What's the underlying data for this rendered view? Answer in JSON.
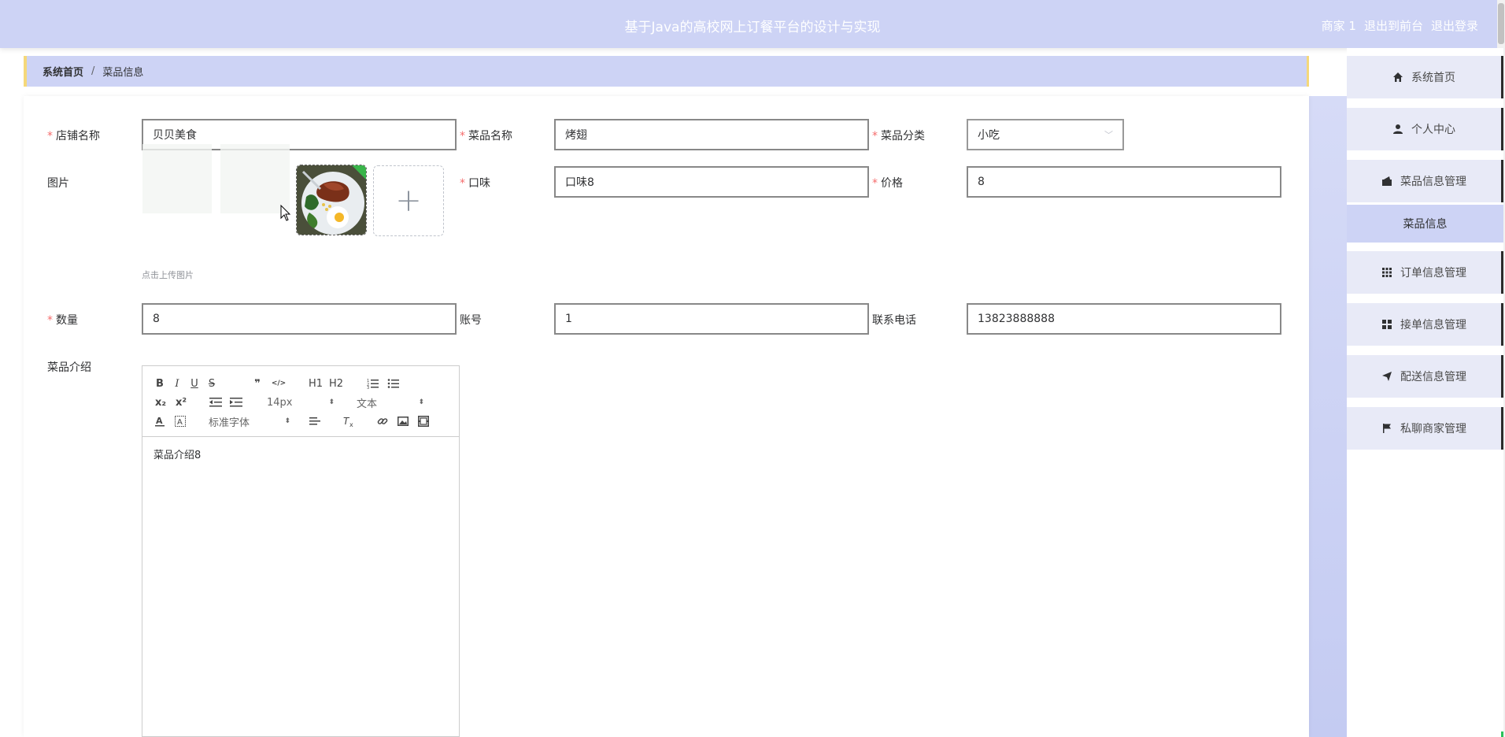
{
  "header": {
    "title": "基于Java的高校网上订餐平台的设计与实现",
    "user": "商家 1",
    "frontend_link": "退出到前台",
    "logout_link": "退出登录"
  },
  "breadcrumb": {
    "home": "系统首页",
    "separator": "/",
    "current": "菜品信息"
  },
  "form": {
    "shop_name": {
      "label": "店铺名称",
      "value": "贝贝美食",
      "required": true
    },
    "dish_name": {
      "label": "菜品名称",
      "value": "烤翅",
      "required": true
    },
    "category": {
      "label": "菜品分类",
      "value": "小吃",
      "required": true
    },
    "image": {
      "label": "图片",
      "tip": "点击上传图片",
      "add_symbol": "+"
    },
    "flavor": {
      "label": "口味",
      "value": "口味8",
      "required": true
    },
    "price": {
      "label": "价格",
      "value": "8",
      "required": true
    },
    "quantity": {
      "label": "数量",
      "value": "8",
      "required": true
    },
    "account": {
      "label": "账号",
      "value": "1",
      "required": false
    },
    "phone": {
      "label": "联系电话",
      "value": "13823888888",
      "required": false
    },
    "intro": {
      "label": "菜品介绍",
      "content": "菜品介绍8"
    }
  },
  "editor_toolbar": {
    "bold": "B",
    "italic": "I",
    "underline": "U",
    "strike": "S",
    "quote": "❞",
    "code": "</>",
    "h1": "H1",
    "h2": "H2",
    "sub": "x₂",
    "sup": "x²",
    "size": "14px",
    "header": "文本",
    "font": "标准字体"
  },
  "sidebar": {
    "items": [
      {
        "label": "系统首页",
        "icon": "home-icon"
      },
      {
        "label": "个人中心",
        "icon": "user-icon"
      },
      {
        "label": "菜品信息管理",
        "icon": "wallet-icon"
      },
      {
        "label": "订单信息管理",
        "icon": "grid-icon"
      },
      {
        "label": "接单信息管理",
        "icon": "apps-icon"
      },
      {
        "label": "配送信息管理",
        "icon": "send-icon"
      },
      {
        "label": "私聊商家管理",
        "icon": "flag-icon"
      }
    ],
    "sub_item": "菜品信息"
  },
  "colors": {
    "header_bg": "#cdd3f5",
    "required": "#f56c6c",
    "breadcrumb_border": "#f5d87a"
  }
}
